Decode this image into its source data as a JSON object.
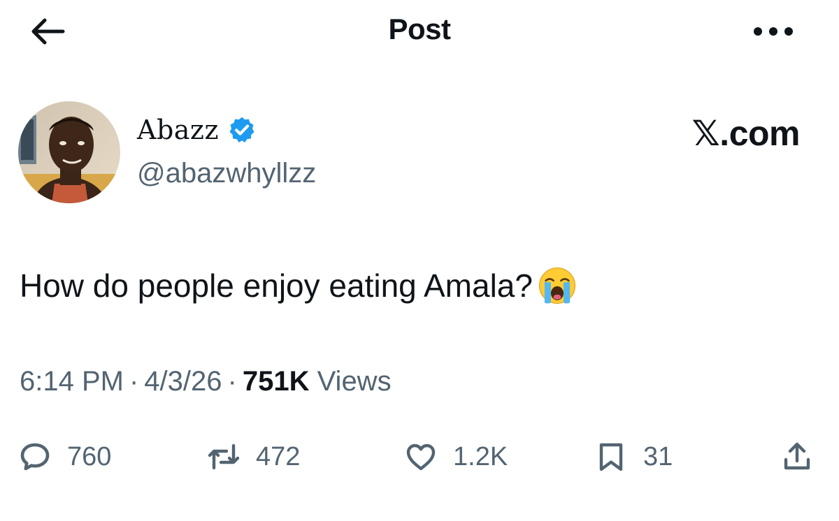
{
  "header": {
    "title": "Post",
    "back_icon": "arrow-left-icon",
    "more_icon": "more-horizontal-icon"
  },
  "author": {
    "display_name": "Abazz",
    "handle": "@abazwhyllzz",
    "verified": true,
    "verified_color": "#1d9bf0"
  },
  "brand": "𝕏.com",
  "post": {
    "text": "How do people enjoy eating Amala?",
    "emoji": "loudly-crying-face-emoji"
  },
  "meta": {
    "time": "6:14 PM",
    "date": "4/3/26",
    "separator": "·",
    "views_count": "751K",
    "views_label": "Views"
  },
  "actions": {
    "reply_count": "760",
    "repost_count": "472",
    "like_count": "1.2K",
    "bookmark_count": "31"
  },
  "colors": {
    "text_primary": "#0f1419",
    "text_secondary": "#536471",
    "accent": "#1d9bf0",
    "background": "#ffffff"
  }
}
